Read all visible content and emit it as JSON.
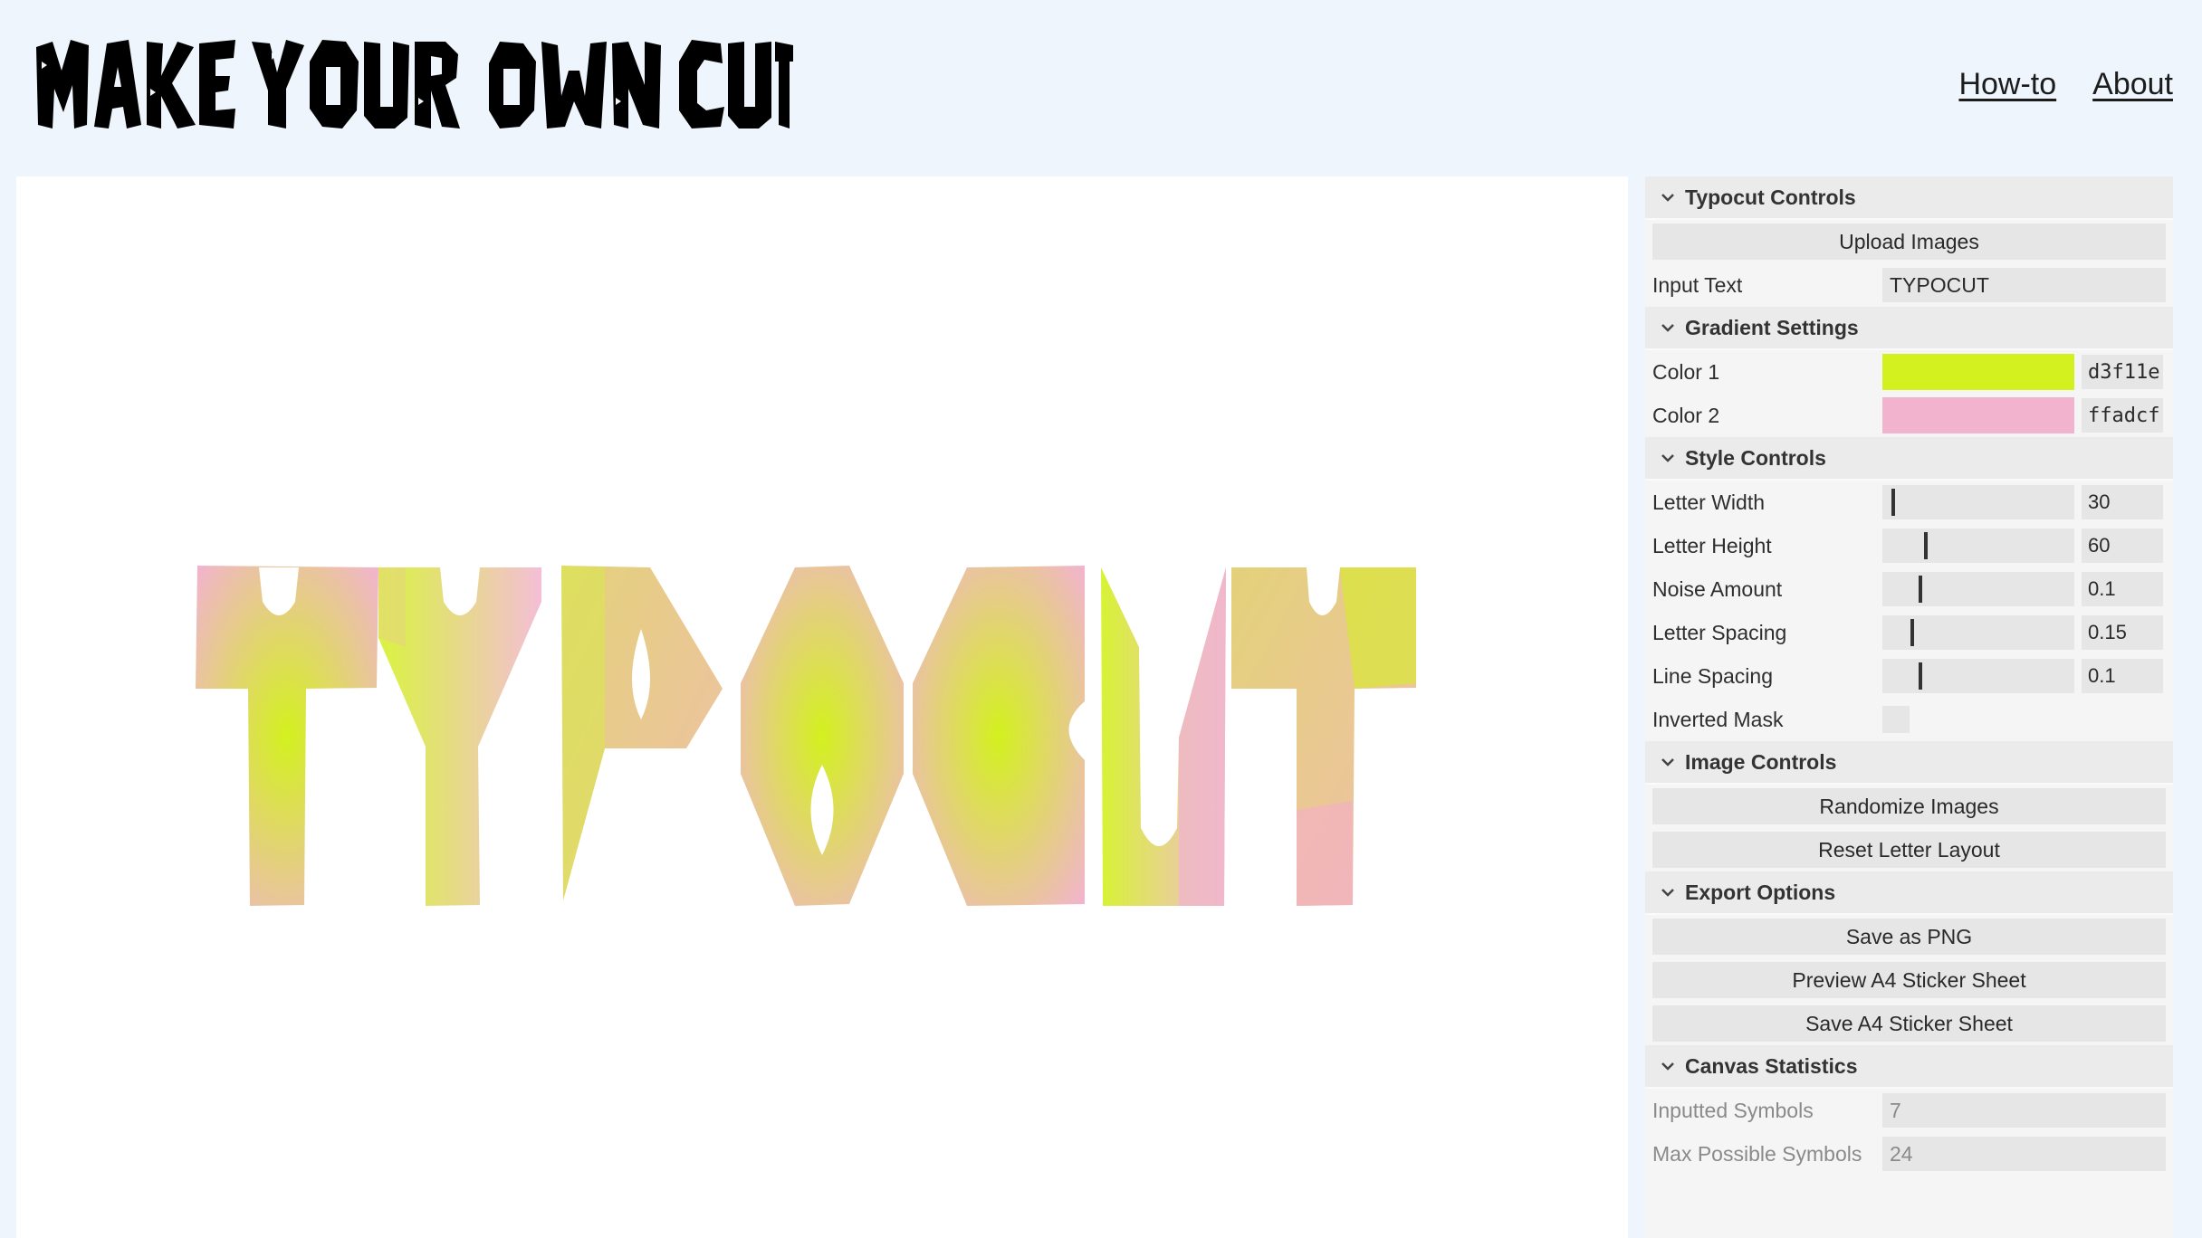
{
  "header": {
    "logo_text": "MAKE YOUR OWN CUTOUTS",
    "nav": [
      {
        "label": "How-to"
      },
      {
        "label": "About"
      }
    ]
  },
  "canvas": {
    "text": "TYPOCUT",
    "letters": [
      "T",
      "Y",
      "P",
      "O",
      "C",
      "U",
      "T"
    ]
  },
  "panel": {
    "controls": {
      "title": "Typocut Controls",
      "upload_label": "Upload Images",
      "input_text_label": "Input Text",
      "input_text_value": "TYPOCUT"
    },
    "gradient": {
      "title": "Gradient Settings",
      "color1_label": "Color 1",
      "color1_hex": "d3f11e",
      "color1_value": "#d3f11e",
      "color2_label": "Color 2",
      "color2_hex": "ffadcf",
      "color2_value": "#f2b3cf"
    },
    "style": {
      "title": "Style Controls",
      "sliders": [
        {
          "label": "Letter Width",
          "value": "30",
          "fraction": 0.05
        },
        {
          "label": "Letter Height",
          "value": "60",
          "fraction": 0.22
        },
        {
          "label": "Noise Amount",
          "value": "0.1",
          "fraction": 0.19
        },
        {
          "label": "Letter Spacing",
          "value": "0.15",
          "fraction": 0.15
        },
        {
          "label": "Line Spacing",
          "value": "0.1",
          "fraction": 0.19
        }
      ],
      "inverted_label": "Inverted Mask",
      "inverted_checked": false
    },
    "image": {
      "title": "Image Controls",
      "randomize_label": "Randomize Images",
      "reset_label": "Reset Letter Layout"
    },
    "export": {
      "title": "Export Options",
      "save_png_label": "Save as PNG",
      "preview_label": "Preview A4 Sticker Sheet",
      "save_sheet_label": "Save A4 Sticker Sheet"
    },
    "stats": {
      "title": "Canvas Statistics",
      "inputted_label": "Inputted Symbols",
      "inputted_value": "7",
      "max_label": "Max Possible Symbols",
      "max_value": "24"
    }
  }
}
